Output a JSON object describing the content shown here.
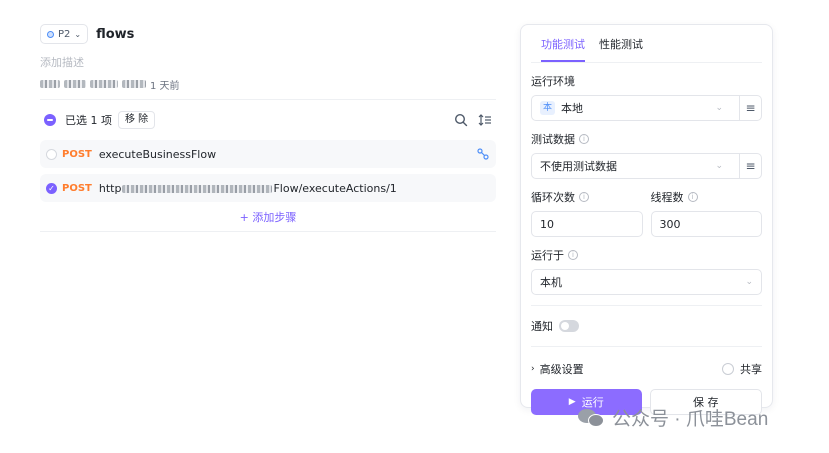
{
  "flow": {
    "priority": "P2",
    "title": "flows",
    "description_placeholder": "添加描述",
    "meta_suffix": "1 天前",
    "selection_text": "已选 1 项",
    "move_label": "移 除",
    "add_step_label": "+ 添加步骤",
    "steps": [
      {
        "method": "POST",
        "name": "executeBusinessFlow",
        "selected": false
      },
      {
        "method": "POST",
        "name_prefix": "http",
        "name_suffix": "Flow/executeActions/1",
        "selected": true
      }
    ]
  },
  "panel": {
    "tabs": [
      {
        "label": "功能测试",
        "active": true
      },
      {
        "label": "性能测试",
        "active": false
      }
    ],
    "env_label": "运行环境",
    "env_badge": "本",
    "env_value": "本地",
    "testdata_label": "测试数据",
    "testdata_value": "不使用测试数据",
    "loop_label": "循环次数",
    "loop_value": "10",
    "threads_label": "线程数",
    "threads_value": "300",
    "runat_label": "运行于",
    "runat_value": "本机",
    "notify_label": "通知",
    "advanced_label": "高级设置",
    "share_label": "共享",
    "run_label": "运行",
    "save_label": "保 存"
  },
  "watermark": {
    "text": "公众号 · 爪哇Bean"
  },
  "colors": {
    "accent": "#7b61ff",
    "method_post": "#ff7d2d",
    "run_button": "#8c6cff"
  }
}
